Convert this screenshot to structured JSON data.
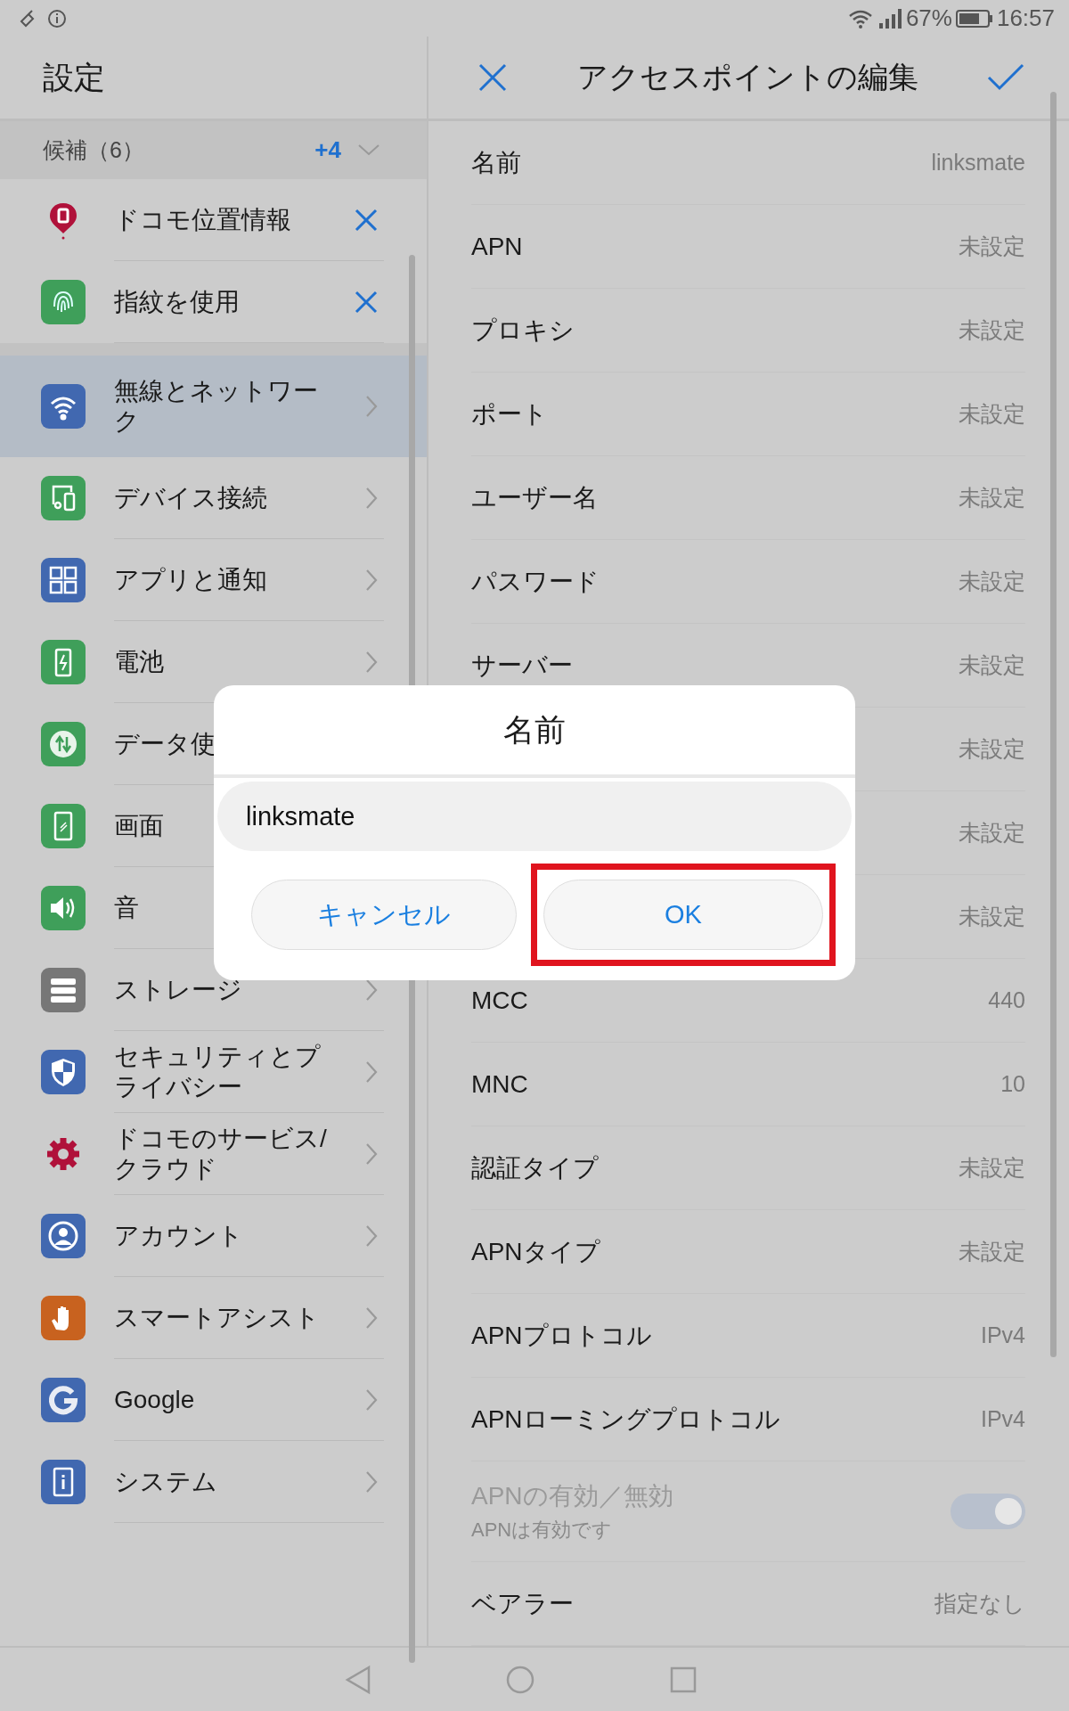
{
  "status_bar": {
    "battery": "67%",
    "time": "16:57"
  },
  "sidebar": {
    "title": "設定",
    "suggestions": {
      "label": "候補（6）",
      "more": "+4",
      "items": [
        {
          "label": "ドコモ位置情報"
        },
        {
          "label": "指紋を使用"
        }
      ]
    },
    "items": [
      {
        "label": "無線とネットワーク",
        "selected": true,
        "chevron": true
      },
      {
        "label": "デバイス接続",
        "selected": false,
        "chevron": true
      },
      {
        "label": "アプリと通知",
        "selected": false,
        "chevron": true
      },
      {
        "label": "電池",
        "selected": false,
        "chevron": true
      },
      {
        "label": "データ使",
        "selected": false,
        "chevron": false
      },
      {
        "label": "画面",
        "selected": false,
        "chevron": false
      },
      {
        "label": "音",
        "selected": false,
        "chevron": false
      },
      {
        "label": "ストレージ",
        "selected": false,
        "chevron": true
      },
      {
        "label": "セキュリティとプライバシー",
        "selected": false,
        "chevron": true
      },
      {
        "label": "ドコモのサービス/クラウド",
        "selected": false,
        "chevron": true
      },
      {
        "label": "アカウント",
        "selected": false,
        "chevron": true
      },
      {
        "label": "スマートアシスト",
        "selected": false,
        "chevron": true
      },
      {
        "label": "Google",
        "selected": false,
        "chevron": true
      },
      {
        "label": "システム",
        "selected": false,
        "chevron": true
      }
    ]
  },
  "editor": {
    "title": "アクセスポイントの編集",
    "rows": [
      {
        "kind": "value",
        "label": "名前",
        "value": "linksmate"
      },
      {
        "kind": "value",
        "label": "APN",
        "value": "未設定"
      },
      {
        "kind": "value",
        "label": "プロキシ",
        "value": "未設定"
      },
      {
        "kind": "value",
        "label": "ポート",
        "value": "未設定"
      },
      {
        "kind": "value",
        "label": "ユーザー名",
        "value": "未設定"
      },
      {
        "kind": "value",
        "label": "パスワード",
        "value": "未設定"
      },
      {
        "kind": "value",
        "label": "サーバー",
        "value": "未設定"
      },
      {
        "kind": "value",
        "value": "未設定"
      },
      {
        "kind": "value",
        "value": "未設定"
      },
      {
        "kind": "value",
        "value": "未設定"
      },
      {
        "kind": "value",
        "label": "MCC",
        "value": "440"
      },
      {
        "kind": "value",
        "label": "MNC",
        "value": "10"
      },
      {
        "kind": "value",
        "label": "認証タイプ",
        "value": "未設定"
      },
      {
        "kind": "value",
        "label": "APNタイプ",
        "value": "未設定"
      },
      {
        "kind": "value",
        "label": "APNプロトコル",
        "value": "IPv4"
      },
      {
        "kind": "value",
        "label": "APNローミングプロトコル",
        "value": "IPv4"
      },
      {
        "kind": "toggle",
        "label": "APNの有効／無効",
        "sublabel": "APNは有効です",
        "on": true,
        "disabled": true
      },
      {
        "kind": "value",
        "label": "ベアラー",
        "value": "指定なし"
      }
    ]
  },
  "dialog": {
    "title": "名前",
    "value": "linksmate",
    "buttons": [
      {
        "label": "キャンセル",
        "highlighted": false
      },
      {
        "label": "OK",
        "highlighted": true
      }
    ]
  }
}
